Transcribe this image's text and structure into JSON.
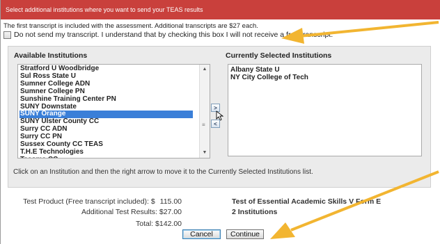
{
  "header": {
    "title": "Select additional institutions where you want to send your TEAS results"
  },
  "info": {
    "text": "The first transcript is included with the assessment. Additional transcripts are $27 each.",
    "optout_label": "Do not send my transcript. I understand that by checking this box I will not receive a free transcript."
  },
  "available": {
    "title": "Available Institutions",
    "items": [
      "Stratford U Woodbridge",
      "Sul Ross State U",
      "Sumner College ADN",
      "Sumner College PN",
      "Sunshine Training Center PN",
      "SUNY Downstate",
      "SUNY Orange",
      "SUNY Ulster County CC",
      "Surry CC ADN",
      "Surry CC PN",
      "Sussex County CC TEAS",
      "T.H.E Technologies",
      "Tacoma CC"
    ],
    "selected_item": "SUNY Orange"
  },
  "move_buttons": {
    "add": ">",
    "remove": "<"
  },
  "selected": {
    "title": "Currently Selected Institutions",
    "items": [
      "Albany State U",
      "NY City College of Tech"
    ]
  },
  "hint": "Click on an Institution and then the right arrow to move it to the Currently Selected Institutions list.",
  "summary": {
    "product_label": "Test Product (Free transcript included): $",
    "product_value": "115.00",
    "additional_label": "Additional Test Results: $27.00",
    "total_label": "Total: $142.00",
    "product_name": "Test of Essential Academic Skills V Form E",
    "institutions_count": "2 Institutions"
  },
  "buttons": {
    "cancel": "Cancel",
    "continue": "Continue"
  },
  "colors": {
    "header": "#c9403c",
    "selection": "#3a7fd8",
    "annotation_arrow": "#f2b531"
  }
}
